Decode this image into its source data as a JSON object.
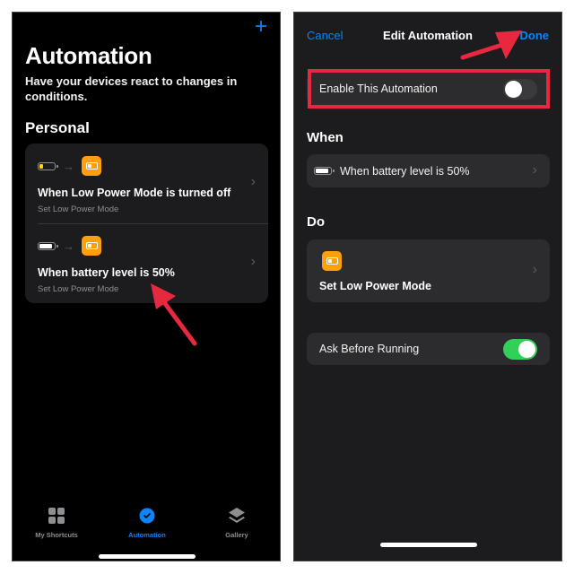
{
  "left": {
    "add_button": "+",
    "title": "Automation",
    "subtitle": "Have your devices react to changes in conditions.",
    "section": "Personal",
    "automations": [
      {
        "trigger_icon": "battery-low-icon",
        "action_icon": "low-power-mode-icon",
        "title": "When Low Power Mode is turned off",
        "action": "Set Low Power Mode"
      },
      {
        "trigger_icon": "battery-full-icon",
        "action_icon": "low-power-mode-icon",
        "title": "When battery level is 50%",
        "action": "Set Low Power Mode"
      }
    ],
    "tabs": [
      {
        "label": "My Shortcuts",
        "icon": "grid-icon",
        "active": false
      },
      {
        "label": "Automation",
        "icon": "automation-check-icon",
        "active": true
      },
      {
        "label": "Gallery",
        "icon": "layers-icon",
        "active": false
      }
    ]
  },
  "right": {
    "nav": {
      "cancel": "Cancel",
      "title": "Edit Automation",
      "done": "Done"
    },
    "enable": {
      "label": "Enable This Automation",
      "on": false
    },
    "when_header": "When",
    "when_item": "When battery level is 50%",
    "do_header": "Do",
    "do_item": "Set Low Power Mode",
    "ask": {
      "label": "Ask Before Running",
      "on": true
    }
  },
  "colors": {
    "accent": "#0a84ff",
    "orange": "#ff9f0a",
    "green": "#30d158",
    "annotation": "#e8283f"
  }
}
